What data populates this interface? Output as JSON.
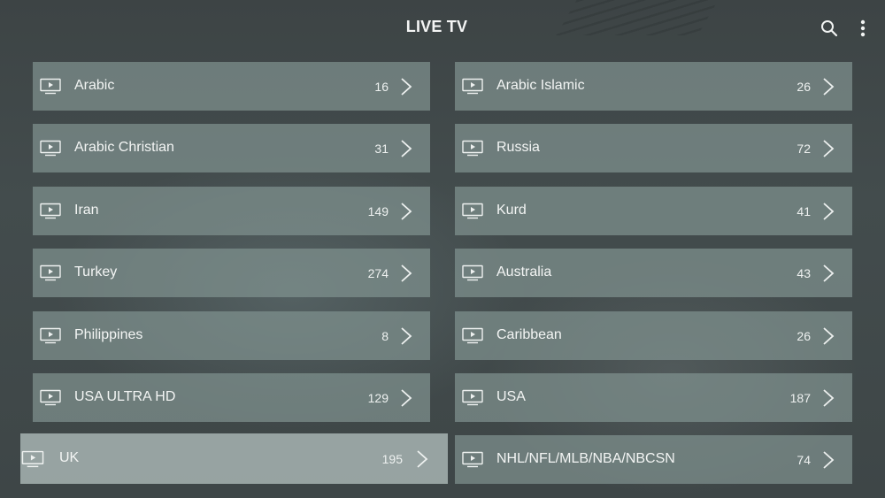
{
  "header": {
    "title": "LIVE TV",
    "search_icon": "search-icon",
    "more_icon": "more-vertical-icon"
  },
  "focused_index": 12,
  "categories": [
    {
      "name": "Arabic",
      "count": "16",
      "icon": "tv-icon"
    },
    {
      "name": "Arabic Islamic",
      "count": "26",
      "icon": "tv-icon"
    },
    {
      "name": "Arabic Christian",
      "count": "31",
      "icon": "tv-icon"
    },
    {
      "name": "Russia",
      "count": "72",
      "icon": "tv-icon"
    },
    {
      "name": "Iran",
      "count": "149",
      "icon": "tv-icon"
    },
    {
      "name": "Kurd",
      "count": "41",
      "icon": "tv-icon"
    },
    {
      "name": "Turkey",
      "count": "274",
      "icon": "tv-icon"
    },
    {
      "name": "Australia",
      "count": "43",
      "icon": "tv-icon"
    },
    {
      "name": "Philippines",
      "count": "8",
      "icon": "tv-icon"
    },
    {
      "name": "Caribbean",
      "count": "26",
      "icon": "tv-icon"
    },
    {
      "name": "USA ULTRA HD",
      "count": "129",
      "icon": "tv-icon"
    },
    {
      "name": "USA",
      "count": "187",
      "icon": "tv-icon"
    },
    {
      "name": "UK",
      "count": "195",
      "icon": "tv-icon"
    },
    {
      "name": "NHL/NFL/MLB/NBA/NBCSN",
      "count": "74",
      "icon": "tv-icon"
    }
  ],
  "colors": {
    "background": "#3f4748",
    "item_bg": "#7a8b89",
    "item_focused_bg": "#a4b0ae",
    "text": "#f3f5f4"
  }
}
